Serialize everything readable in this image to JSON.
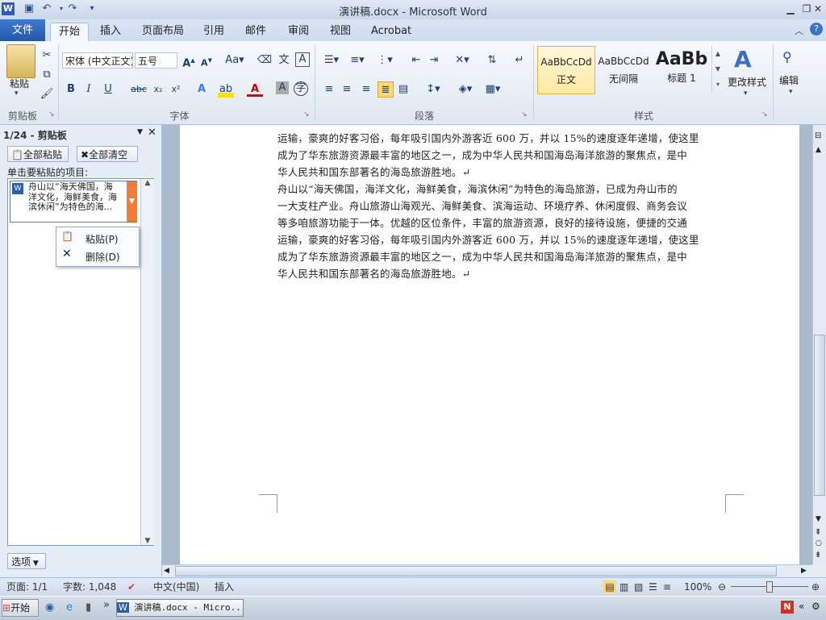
{
  "window": {
    "title": "演讲稿.docx - Microsoft Word"
  },
  "tabs": [
    "文件",
    "开始",
    "插入",
    "页面布局",
    "引用",
    "邮件",
    "审阅",
    "视图",
    "Acrobat"
  ],
  "ribbon": {
    "paste_label": "粘贴",
    "font_name": "宋体 (中文正文)",
    "font_size": "五号",
    "groups": {
      "clipboard": "剪贴板",
      "font": "字体",
      "paragraph": "段落",
      "styles": "样式"
    },
    "styles": [
      {
        "sample": "AaBbCcDd",
        "name": "正文"
      },
      {
        "sample": "AaBbCcDd",
        "name": "无间隔"
      },
      {
        "sample": "AaBb",
        "name": "标题 1"
      }
    ],
    "change_styles": "更改样式",
    "edit": "编辑"
  },
  "clipboard_pane": {
    "title": "1/24 - 剪贴板",
    "paste_all": "全部粘贴",
    "clear_all": "全部清空",
    "prompt": "单击要粘贴的项目:",
    "item_lines": [
      "舟山以“海天佛国，海",
      "洋文化，海鲜美食，海",
      "滨休闲”为特色的海..."
    ],
    "menu": [
      {
        "label": "粘贴(P)"
      },
      {
        "label": "删除(D)"
      }
    ],
    "options": "选项"
  },
  "document": {
    "lines": [
      "运输，豪爽的好客习俗，每年吸引国内外游客近 600 万，并以 15%的速度逐年递增，使这里",
      "成为了华东旅游资源最丰富的地区之一，成为中华人民共和国海岛海洋旅游的聚焦点，是中",
      "华人民共和国东部著名的海岛旅游胜地。↵",
      "舟山以“海天佛国，海洋文化，海鲜美食，海滨休闲”为特色的海岛旅游，已成为舟山市的",
      "一大支柱产业。舟山旅游山海观光、海鲜美食、滨海运动、环境疗养、休闲度假、商务会议",
      "等多咱旅游功能于一体。优越的区位条件，丰富的旅游资源，良好的接待设施，便捷的交通",
      "运输，豪爽的好客习俗，每年吸引国内外游客近 600 万，并以 15%的速度逐年递增，使这里",
      "成为了华东旅游资源最丰富的地区之一，成为中华人民共和国海岛海洋旅游的聚焦点，是中",
      "华人民共和国东部著名的海岛旅游胜地。↵"
    ]
  },
  "status": {
    "page": "页面: 1/1",
    "words": "字数: 1,048",
    "language": "中文(中国)",
    "mode": "插入",
    "zoom": "100%"
  },
  "taskbar": {
    "start": "开始",
    "window_button": "演讲稿.docx - Micro..."
  },
  "colors": {
    "file_tab": "#2b5fae",
    "clip_highlight": "#f37b38",
    "page_bg": "#ffffff",
    "doc_bg": "#abb9cc"
  }
}
